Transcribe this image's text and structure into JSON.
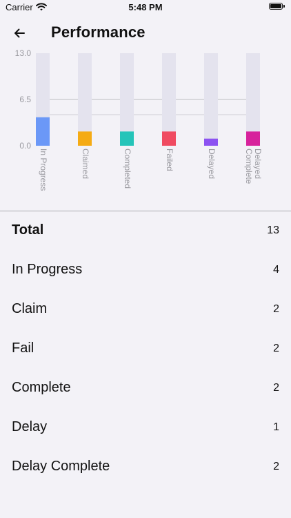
{
  "status_bar": {
    "carrier": "Carrier",
    "time": "5:48 PM"
  },
  "header": {
    "title": "Performance"
  },
  "chart_data": {
    "type": "bar",
    "categories": [
      "In Progress",
      "Claimed",
      "Completed",
      "Failed",
      "Delayed",
      "Delayed Complete"
    ],
    "category_label_lines": [
      [
        "In Progress"
      ],
      [
        "Claimed"
      ],
      [
        "Completed"
      ],
      [
        "Failed"
      ],
      [
        "Delayed"
      ],
      [
        "Delayed",
        "Complete"
      ]
    ],
    "values": [
      4,
      2,
      2,
      2,
      1,
      2
    ],
    "max": 13,
    "colors": [
      "#6b98f7",
      "#f5ab14",
      "#25c4b9",
      "#f04b61",
      "#8c52f1",
      "#d7229c"
    ],
    "track_color": "#e4e3ee",
    "ylim": [
      0,
      13
    ],
    "yticks": [
      "13.0",
      "6.5",
      "0.0"
    ],
    "grid": true
  },
  "summary": {
    "rows": [
      {
        "label": "Total",
        "value": "13"
      },
      {
        "label": "In Progress",
        "value": "4"
      },
      {
        "label": "Claim",
        "value": "2"
      },
      {
        "label": "Fail",
        "value": "2"
      },
      {
        "label": "Complete",
        "value": "2"
      },
      {
        "label": "Delay",
        "value": "1"
      },
      {
        "label": "Delay Complete",
        "value": "2"
      }
    ]
  }
}
